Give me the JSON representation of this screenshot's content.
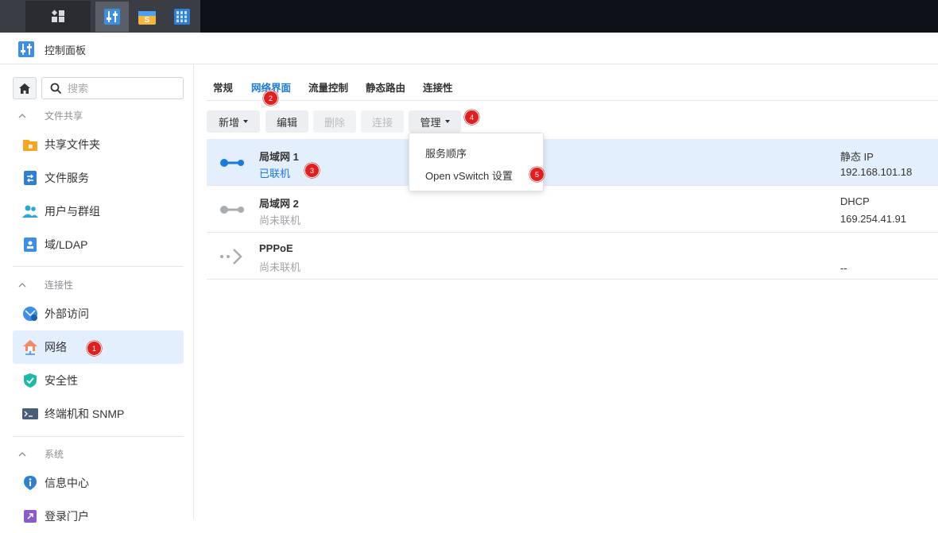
{
  "window": {
    "title": "控制面板"
  },
  "sidebar": {
    "search_placeholder": "搜索",
    "sections": [
      {
        "label": "文件共享",
        "items": [
          "共享文件夹",
          "文件服务",
          "用户与群组",
          "域/LDAP"
        ]
      },
      {
        "label": "连接性",
        "items": [
          "外部访问",
          "网络",
          "安全性",
          "终端机和 SNMP"
        ]
      },
      {
        "label": "系统",
        "items": [
          "信息中心",
          "登录门户"
        ]
      }
    ],
    "selected_item": "网络"
  },
  "tabs": [
    "常规",
    "网络界面",
    "流量控制",
    "静态路由",
    "连接性"
  ],
  "active_tab": "网络界面",
  "toolbar": {
    "add": "新增",
    "edit": "编辑",
    "delete": "删除",
    "connect": "连接",
    "manage": "管理"
  },
  "interfaces": [
    {
      "name": "局域网 1",
      "status": "已联机",
      "type": "静态 IP",
      "ip": "192.168.101.18"
    },
    {
      "name": "局域网 2",
      "status": "尚未联机",
      "type": "DHCP",
      "ip": "169.254.41.91"
    },
    {
      "name": "PPPoE",
      "status": "尚未联机",
      "type": "",
      "ip": "--"
    }
  ],
  "manage_menu": [
    "服务顺序",
    "Open vSwitch 设置"
  ],
  "badges": [
    "1",
    "2",
    "3",
    "4",
    "5"
  ],
  "colors": {
    "accent": "#1a7ae0",
    "selected_bg": "#e3effc",
    "badge": "#e31e1e"
  }
}
